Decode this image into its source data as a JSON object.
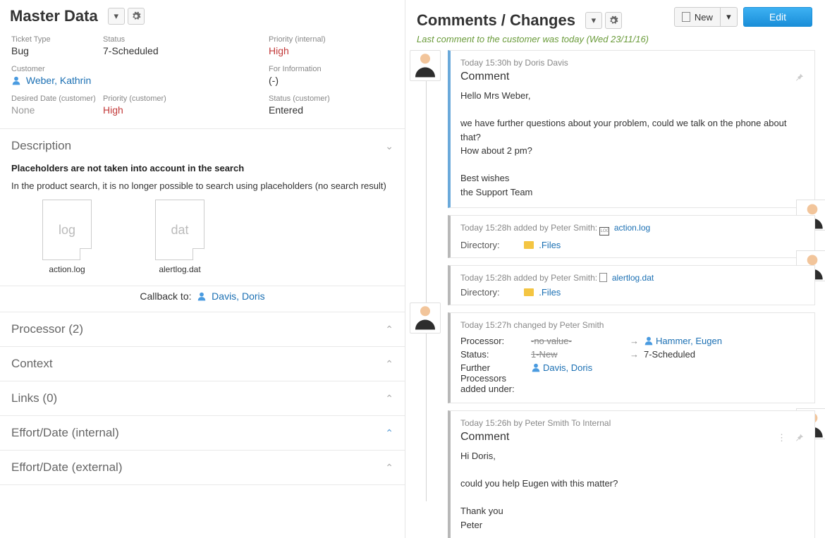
{
  "header": {
    "title": "Master Data"
  },
  "actions": {
    "new_label": "New",
    "edit_label": "Edit"
  },
  "fields": {
    "ticket_type_label": "Ticket Type",
    "ticket_type_value": "Bug",
    "status_label": "Status",
    "status_value": "7-Scheduled",
    "priority_internal_label": "Priority (internal)",
    "priority_internal_value": "High",
    "customer_label": "Customer",
    "customer_value": "Weber, Kathrin",
    "for_info_label": "For Information",
    "for_info_value": "(-)",
    "desired_date_label": "Desired Date (customer)",
    "desired_date_value": "None",
    "priority_customer_label": "Priority (customer)",
    "priority_customer_value": "High",
    "status_customer_label": "Status (customer)",
    "status_customer_value": "Entered"
  },
  "description": {
    "heading": "Description",
    "title": "Placeholders are not taken into account in the search",
    "text": "In the product search, it is no longer possible to search using placeholders (no search result)",
    "attachments": [
      {
        "ext": "log",
        "name": "action.log"
      },
      {
        "ext": "dat",
        "name": "alertlog.dat"
      }
    ]
  },
  "callback": {
    "label": "Callback to:",
    "person": "Davis, Doris"
  },
  "sections": {
    "processor": "Processor (2)",
    "context": "Context",
    "links": "Links (0)",
    "effort_internal": "Effort/Date (internal)",
    "effort_external": "Effort/Date (external)"
  },
  "comments_header": {
    "title": "Comments / Changes",
    "last": "Last comment to the customer was today (Wed 23/11/16)"
  },
  "entries": {
    "e1": {
      "meta": "Today 15:30h by Doris Davis",
      "title": "Comment",
      "body": "Hello Mrs Weber,\n\nwe have further questions about your problem, could we talk on the phone about that?\nHow about 2 pm?\n\nBest wishes\nthe Support Team"
    },
    "e2": {
      "meta": "Today 15:28h added by Peter Smith:",
      "file": "action.log",
      "dir_label": "Directory:",
      "dir_value": ".Files"
    },
    "e3": {
      "meta": "Today 15:28h added by Peter Smith:",
      "file": "alertlog.dat",
      "dir_label": "Directory:",
      "dir_value": ".Files"
    },
    "e4": {
      "meta": "Today 15:27h changed by Peter Smith",
      "processor_label": "Processor:",
      "processor_old": "-no value-",
      "processor_new": "Hammer, Eugen",
      "status_label": "Status:",
      "status_old": "1-New",
      "status_new": "7-Scheduled",
      "further_label": "Further Processors added under:",
      "further_value": "Davis, Doris"
    },
    "e5": {
      "meta": "Today 15:26h by Peter Smith To Internal",
      "title": "Comment",
      "body": "Hi Doris,\n\ncould you help Eugen with this matter?\n\nThank you\nPeter"
    }
  }
}
